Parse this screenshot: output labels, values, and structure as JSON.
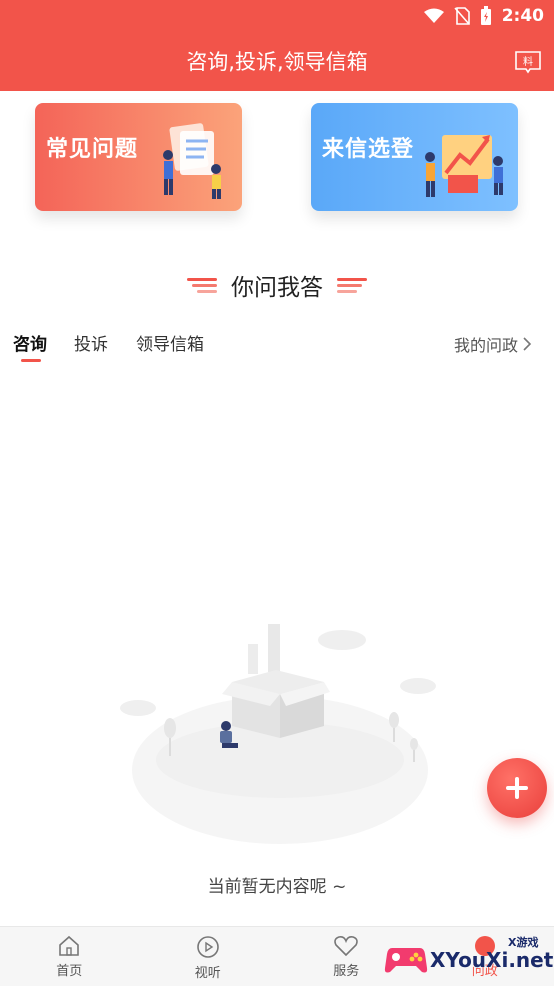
{
  "status_bar": {
    "time": "2:40"
  },
  "header": {
    "title": "咨询,投诉,领导信箱",
    "icon": "newspaper-icon"
  },
  "cards": [
    {
      "label": "常见问题",
      "color_start": "#f46458",
      "color_end": "#fba37a"
    },
    {
      "label": "来信选登",
      "color_start": "#5aa8f8",
      "color_end": "#7ec0ff"
    }
  ],
  "section": {
    "title": "你问我答"
  },
  "tabs": [
    {
      "label": "咨询",
      "active": true
    },
    {
      "label": "投诉",
      "active": false
    },
    {
      "label": "领导信箱",
      "active": false
    }
  ],
  "my_questions": {
    "label": "我的问政"
  },
  "empty_state": {
    "text": "当前暂无内容呢 ~"
  },
  "fab": {
    "icon": "plus-icon"
  },
  "bottom_nav": [
    {
      "label": "首页",
      "icon": "home-icon"
    },
    {
      "label": "视听",
      "icon": "play-icon"
    },
    {
      "label": "服务",
      "icon": "heart-icon"
    },
    {
      "label": "问政",
      "icon": "question-icon",
      "active": true
    }
  ],
  "watermark": {
    "text": "XYouXi.net",
    "small": "X游戏"
  },
  "accent_color": "#f2544a"
}
